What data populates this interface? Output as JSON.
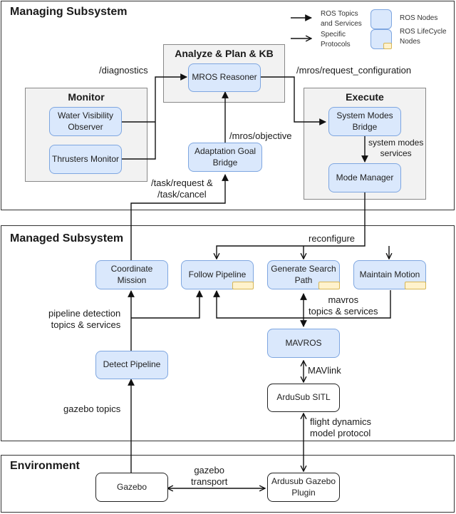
{
  "sections": {
    "managing": "Managing Subsystem",
    "managed": "Managed Subsystem",
    "environment": "Environment"
  },
  "groups": {
    "monitor": "Monitor",
    "analyze": "Analyze & Plan & KB",
    "execute": "Execute"
  },
  "legend": {
    "topics_arrow": "ROS Topics\nand Services",
    "protocol_arrow": "Specific\nProtocols",
    "ros_nodes": "ROS Nodes",
    "lifecycle_nodes": "ROS LifeCycle\nNodes"
  },
  "nodes": {
    "water_visibility": "Water Visibility\nObserver",
    "thrusters_monitor": "Thrusters Monitor",
    "mros_reasoner": "MROS Reasoner",
    "adaptation_goal": "Adaptation Goal\nBridge",
    "system_modes_bridge": "System Modes\nBridge",
    "mode_manager": "Mode Manager",
    "coordinate_mission": "Coordinate\nMission",
    "follow_pipeline": "Follow Pipeline",
    "generate_search": "Generate Search\nPath",
    "maintain_motion": "Maintain Motion",
    "detect_pipeline": "Detect Pipeline",
    "mavros": "MAVROS",
    "ardusub_sitl": "ArduSub SITL",
    "gazebo": "Gazebo",
    "ardusub_plugin": "Ardusub Gazebo\nPlugin"
  },
  "edge_labels": {
    "diagnostics": "/diagnostics",
    "request_configuration": "/mros/request_configuration",
    "objective": "/mros/objective",
    "system_modes_services": "system modes\nservices",
    "task_request": "/task/request &\n/task/cancel",
    "reconfigure": "reconfigure",
    "pipeline_detection": "pipeline detection\ntopics & services",
    "mavros_topics": "mavros\ntopics & services",
    "mavlink": "MAVlink",
    "gazebo_topics": "gazebo topics",
    "flight_dynamics": "flight dynamics\nmodel protocol",
    "gazebo_transport": "gazebo\ntransport"
  }
}
